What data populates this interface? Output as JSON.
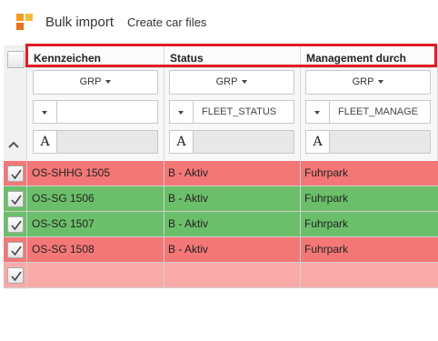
{
  "toolbar": {
    "title": "Bulk import",
    "create_label": "Create car files",
    "logo_colors": [
      "#f59b1c",
      "#e8731c",
      "#f5b93b"
    ]
  },
  "columns": [
    {
      "title": "Kennzeichen",
      "group_label": "GRP",
      "filter_value": ""
    },
    {
      "title": "Status",
      "group_label": "GRP",
      "filter_value": "FLEET_STATUS"
    },
    {
      "title": "Management durch",
      "group_label": "GRP",
      "filter_value": "FLEET_MANAGE"
    }
  ],
  "text_filter_glyph": "A",
  "sort_icon": "chevron-up-icon",
  "highlight_color": "#e11c24",
  "rows": [
    {
      "checked": true,
      "color": "#f47777",
      "cells": [
        "OS-SHHG 1505",
        "B - Aktiv",
        "Fuhrpark"
      ]
    },
    {
      "checked": true,
      "color": "#6cbf6a",
      "cells": [
        "OS-SG 1506",
        "B - Aktiv",
        "Fuhrpark"
      ]
    },
    {
      "checked": true,
      "color": "#6cbf6a",
      "cells": [
        "OS-SG 1507",
        "B - Aktiv",
        "Fuhrpark"
      ]
    },
    {
      "checked": true,
      "color": "#f47777",
      "cells": [
        "OS-SG 1508",
        "B - Aktiv",
        "Fuhrpark"
      ]
    },
    {
      "checked": true,
      "color": "#f9aaa8",
      "cells": [
        "",
        "",
        ""
      ]
    }
  ]
}
